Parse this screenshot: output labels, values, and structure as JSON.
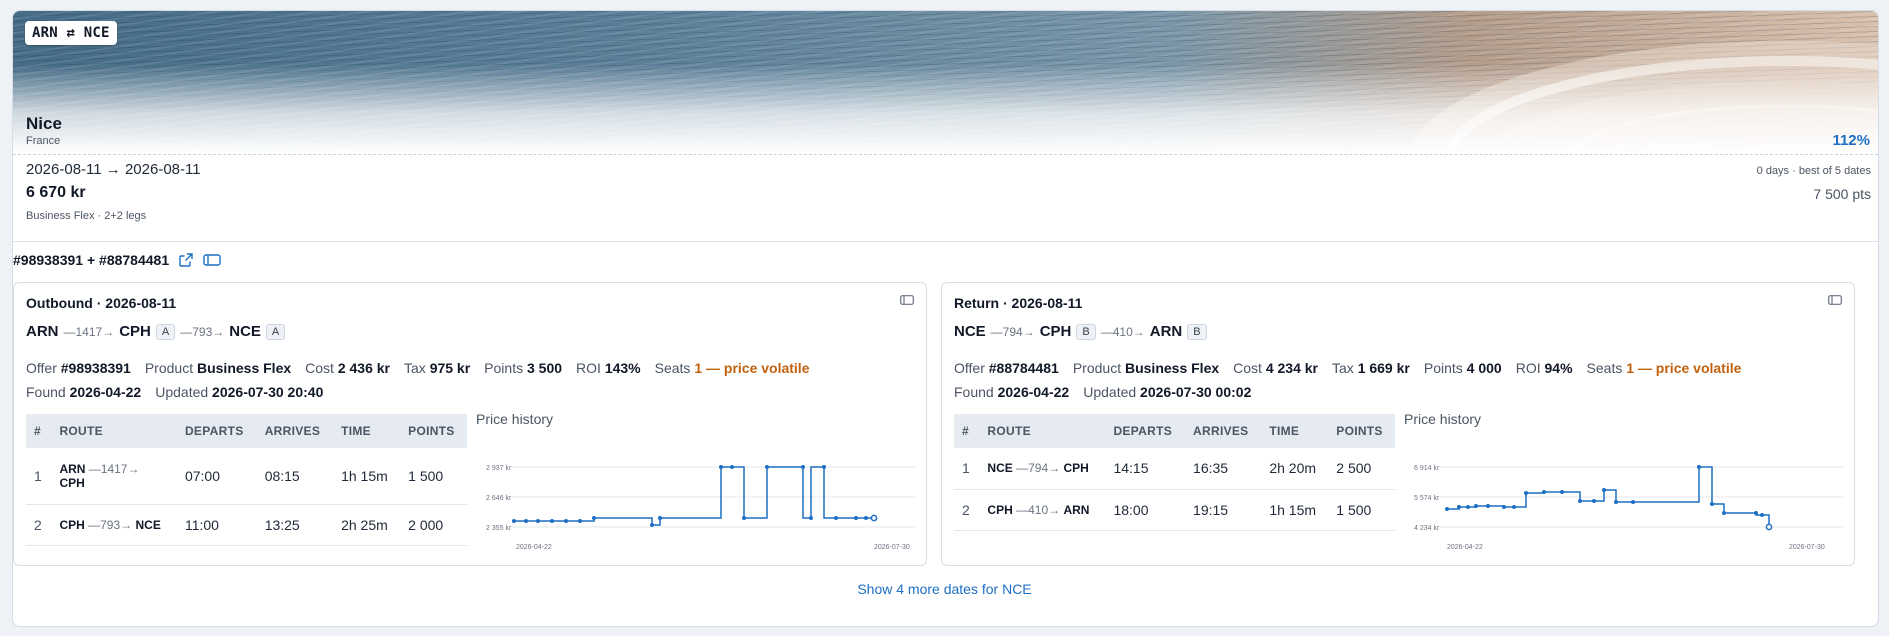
{
  "route_badge": "ARN ⇄ NCE",
  "destination": {
    "city": "Nice",
    "country": "France",
    "percent": "112%"
  },
  "summary": {
    "dates": "2026-08-11 → 2026-08-11",
    "price": "6 670 kr",
    "subtitle": "Business Flex · 2+2 legs",
    "days_info": "0 days · best of 5 dates",
    "points": "7 500 pts"
  },
  "offer_ids": "#98938391 + #88784481",
  "outbound": {
    "title": "Outbound · 2026-08-11",
    "legs_path": [
      {
        "code": "ARN"
      },
      {
        "arrow": "—1417→"
      },
      {
        "code": "CPH",
        "cls": "A"
      },
      {
        "arrow": "—793→"
      },
      {
        "code": "NCE",
        "cls": "A"
      }
    ],
    "offer": "#98938391",
    "product": "Business Flex",
    "cost": "2 436 kr",
    "tax": "975 kr",
    "points": "3 500",
    "roi": "143%",
    "seats": "1 — price volatile",
    "found": "2026-04-22",
    "updated": "2026-07-30 20:40",
    "table": {
      "headers": [
        "#",
        "ROUTE",
        "DEPARTS",
        "ARRIVES",
        "TIME",
        "POINTS"
      ],
      "rows": [
        {
          "n": "1",
          "from": "ARN",
          "flight": "—1417→",
          "to": "CPH",
          "dep": "07:00",
          "arr": "08:15",
          "time": "1h 15m",
          "points": "1 500"
        },
        {
          "n": "2",
          "from": "CPH",
          "flight": "—793→",
          "to": "NCE",
          "dep": "11:00",
          "arr": "13:25",
          "time": "2h 25m",
          "points": "2 000"
        }
      ]
    },
    "history": {
      "title": "Price history",
      "y_ticks": [
        "2 937 kr",
        "2 646 kr",
        "2 355 kr"
      ],
      "x_ticks": [
        "2026-04-22",
        "2026-07-30"
      ]
    }
  },
  "return": {
    "title": "Return · 2026-08-11",
    "legs_path": [
      {
        "code": "NCE"
      },
      {
        "arrow": "—794→"
      },
      {
        "code": "CPH",
        "cls": "B"
      },
      {
        "arrow": "—410→"
      },
      {
        "code": "ARN",
        "cls": "B"
      }
    ],
    "offer": "#88784481",
    "product": "Business Flex",
    "cost": "4 234 kr",
    "tax": "1 669 kr",
    "points": "4 000",
    "roi": "94%",
    "seats": "1 — price volatile",
    "found": "2026-04-22",
    "updated": "2026-07-30 00:02",
    "table": {
      "headers": [
        "#",
        "ROUTE",
        "DEPARTS",
        "ARRIVES",
        "TIME",
        "POINTS"
      ],
      "rows": [
        {
          "n": "1",
          "from": "NCE",
          "flight": "—794→",
          "to": "CPH",
          "dep": "14:15",
          "arr": "16:35",
          "time": "2h 20m",
          "points": "2 500"
        },
        {
          "n": "2",
          "from": "CPH",
          "flight": "—410→",
          "to": "ARN",
          "dep": "18:00",
          "arr": "19:15",
          "time": "1h 15m",
          "points": "1 500"
        }
      ]
    },
    "history": {
      "title": "Price history",
      "y_ticks": [
        "6 914 kr",
        "5 574 kr",
        "4 234 kr"
      ],
      "x_ticks": [
        "2026-04-22",
        "2026-07-30"
      ]
    }
  },
  "labels": {
    "offer": "Offer",
    "product": "Product",
    "cost": "Cost",
    "tax": "Tax",
    "points": "Points",
    "roi": "ROI",
    "seats": "Seats",
    "found": "Found",
    "updated": "Updated"
  },
  "show_more": "Show 4 more dates for NCE",
  "colors": {
    "accent": "#1d6fc4",
    "warning": "#c2620e",
    "line": "#1d6fc4"
  }
}
